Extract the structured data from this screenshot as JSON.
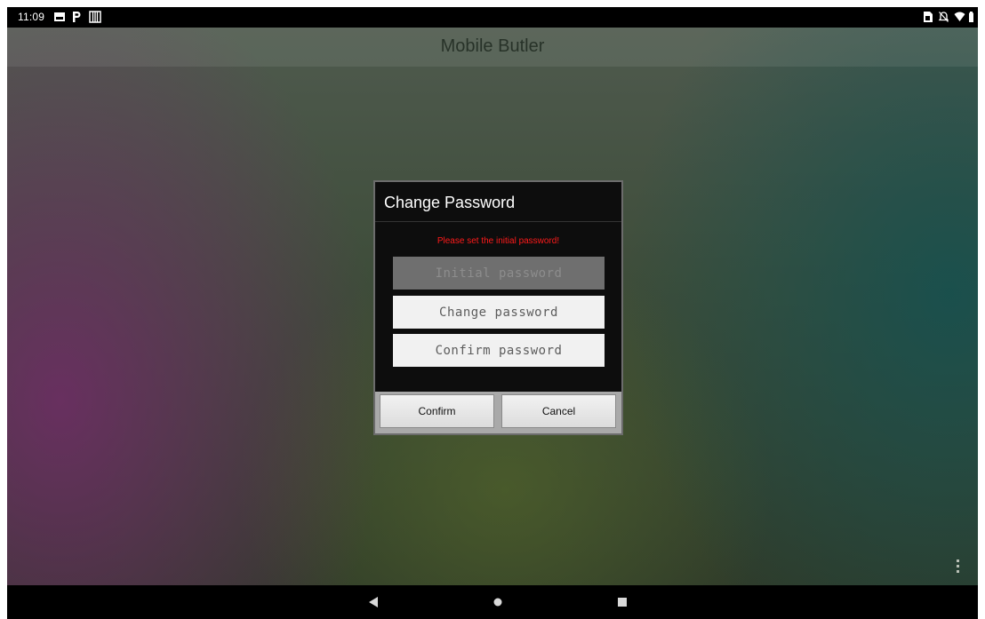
{
  "status_bar": {
    "time": "11:09",
    "left_icons": [
      "image-icon",
      "p-icon",
      "grid-app-icon"
    ],
    "right_icons": [
      "sim-icon",
      "bell-off-icon",
      "wifi-icon",
      "battery-icon"
    ]
  },
  "app": {
    "title": "Mobile Butler"
  },
  "dialog": {
    "title": "Change Password",
    "message": "Please set the initial password!",
    "fields": {
      "initial_placeholder": "Initial password",
      "change_placeholder": "Change password",
      "confirm_placeholder": "Confirm password"
    },
    "buttons": {
      "confirm": "Confirm",
      "cancel": "Cancel"
    }
  },
  "nav_bar": {
    "icons": [
      "back-icon",
      "home-icon",
      "recents-icon"
    ]
  },
  "colors": {
    "message_red": "#ff1a1a",
    "dialog_bg": "#0d0d0d",
    "button_bar_bg": "#a9a9a9"
  }
}
